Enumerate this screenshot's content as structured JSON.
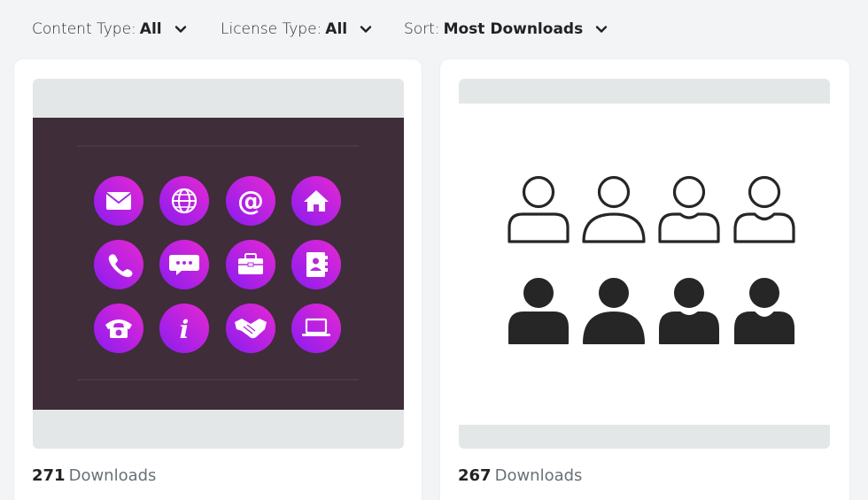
{
  "filters": [
    {
      "label": "Content Type:",
      "value": "All",
      "icon": "chevron-down-icon"
    },
    {
      "label": "License Type:",
      "value": "All",
      "icon": "chevron-down-icon"
    },
    {
      "label": "Sort:",
      "value": "Most Downloads",
      "icon": "chevron-down-icon"
    }
  ],
  "cards": [
    {
      "downloads_count": "271",
      "downloads_label": "Downloads",
      "preview_background": "#3f2d3a",
      "icon_gradient": [
        "#8a1cf0",
        "#e628d2"
      ],
      "icons": [
        "mail-icon",
        "globe-icon",
        "at-sign-icon",
        "home-icon",
        "phone-icon",
        "chat-icon",
        "briefcase-icon",
        "contact-book-icon",
        "telephone-icon",
        "info-icon",
        "handshake-icon",
        "laptop-icon"
      ]
    },
    {
      "downloads_count": "267",
      "downloads_label": "Downloads",
      "preview_background": "#ffffff",
      "icon_color": "#262626",
      "icons": [
        "user-outline-icon",
        "user-outline-icon",
        "user-outline-icon",
        "user-outline-icon",
        "user-filled-icon",
        "user-filled-icon",
        "user-filled-icon",
        "user-filled-icon"
      ]
    }
  ]
}
